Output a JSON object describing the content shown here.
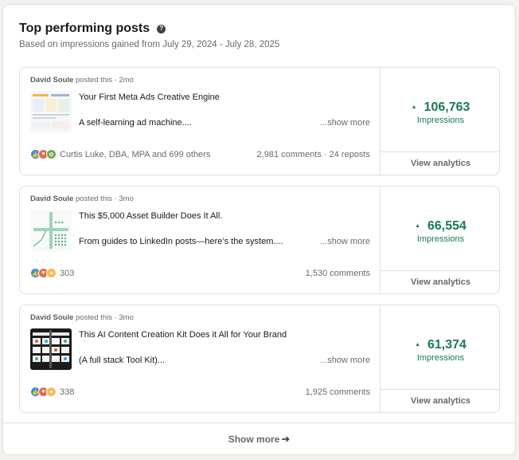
{
  "header": {
    "title": "Top performing posts",
    "subtitle": "Based on impressions gained from July 29, 2024 - July 28, 2025"
  },
  "posts": [
    {
      "author": "David Soule",
      "posted_text": " posted this · 2mo",
      "headline": "Your First Meta Ads Creative Engine",
      "excerpt": "A self-learning ad machine....",
      "show_more": "...show more",
      "reactions_text": "Curtis Luke, DBA, MPA and 699 others",
      "counts": "2,981 comments · 24 reposts",
      "impressions": "106,763",
      "impressions_label": "Impressions",
      "analytics_label": "View analytics"
    },
    {
      "author": "David Soule",
      "posted_text": " posted this · 3mo",
      "headline": "This $5,000 Asset Builder Does It All.",
      "excerpt": "From guides to LinkedIn posts—here’s the system....",
      "show_more": "...show more",
      "reactions_text": "303",
      "counts": "1,530 comments",
      "impressions": "66,554",
      "impressions_label": "Impressions",
      "analytics_label": "View analytics"
    },
    {
      "author": "David Soule",
      "posted_text": " posted this · 3mo",
      "headline": "This AI Content Creation Kit Does it All for Your Brand",
      "excerpt": "(A full stack Tool Kit)...",
      "show_more": "...show more",
      "reactions_text": "338",
      "counts": "1,925 comments",
      "impressions": "61,374",
      "impressions_label": "Impressions",
      "analytics_label": "View analytics"
    }
  ],
  "footer": {
    "show_more_label": "Show more"
  },
  "colors": {
    "impressions_green": "#1a7a52",
    "like_blue": "#378fe9",
    "love_red": "#df704d",
    "support_green": "#6dae4f",
    "insight_yellow": "#f5bb5c"
  }
}
